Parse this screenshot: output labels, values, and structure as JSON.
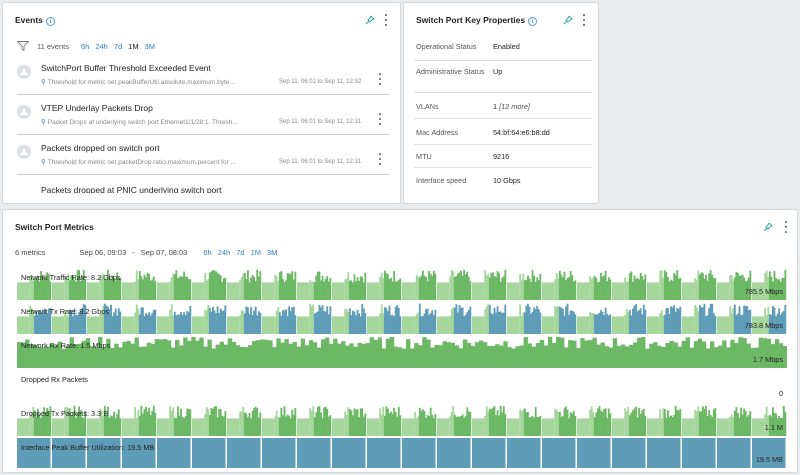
{
  "events": {
    "title": "Events",
    "count": "11 events",
    "ranges": [
      "6h",
      "24h",
      "7d",
      "1M",
      "3M"
    ],
    "active_range": "1M",
    "items": [
      {
        "title": "SwitchPort Buffer Threshold Exceeded Event",
        "desc": "Threshold for metric net.peakBufferUtil.absolute.maximum.byte...",
        "time": "Sep 11, 06:02 to Sep 11, 12:32"
      },
      {
        "title": "VTEP Underlay Packets Drop",
        "desc": "Packet Drops at underlying switch port Ethernet1/1/28:1. Thresh...",
        "time": "Sep 11, 06:01 to Sep 11, 12:31"
      },
      {
        "title": "Packets dropped on switch port",
        "desc": "Threshold for metric net.packetDrop.ratio.maximum.percent for ...",
        "time": "Sep 11, 06:01 to Sep 11, 12:31"
      },
      {
        "title": "Packets dropped at PNIC underlying switch port",
        "desc": "",
        "time": ""
      }
    ]
  },
  "props": {
    "title": "Switch Port Key Properties",
    "rows": [
      {
        "key": "Operational Status",
        "value": "Enabled",
        "extra": ""
      },
      {
        "key": "Administrative Status",
        "value": "Up",
        "extra": ""
      },
      {
        "key": "VLANs",
        "value": "1",
        "extra": "[12 more]"
      },
      {
        "key": "Mac Address",
        "value": "54:bf:64:e6:b8:dd",
        "extra": ""
      },
      {
        "key": "MTU",
        "value": "9216",
        "extra": ""
      },
      {
        "key": "Interface speed",
        "value": "10 Gbps",
        "extra": ""
      }
    ]
  },
  "metrics": {
    "title": "Switch Port Metrics",
    "count": "6 metrics",
    "date_from": "Sep 06, 09:03",
    "date_sep": "-",
    "date_to": "Sep 07, 08:03",
    "ranges": [
      "6h",
      "24h",
      "7d",
      "1M",
      "3M"
    ],
    "colors": {
      "green": "#6cb865",
      "blue": "#5e9cb8",
      "green_light": "#a5d79c"
    },
    "strips": [
      {
        "label": "Network Traffic Rate: 8.2 Gbps",
        "value": "785.5 Mbps",
        "pattern": "blocks",
        "color": "green"
      },
      {
        "label": "Network Tx Rate: 8.2 Gbps",
        "value": "783.8 Mbps",
        "pattern": "blocks",
        "color": "blue"
      },
      {
        "label": "Network Rx Rate: 1.5 Mbps",
        "value": "1.7 Mbps",
        "pattern": "fill",
        "color": "green"
      },
      {
        "label": "Dropped Rx Packets",
        "value": "0",
        "pattern": "empty",
        "color": "green"
      },
      {
        "label": "Dropped Tx Packets: 3.3 B",
        "value": "1.1 M",
        "pattern": "blocks",
        "color": "green"
      },
      {
        "label": "Interface Peak Buffer Utilization: 19.5 MB",
        "value": "19.5 MB",
        "pattern": "solid",
        "color": "blue"
      }
    ]
  }
}
